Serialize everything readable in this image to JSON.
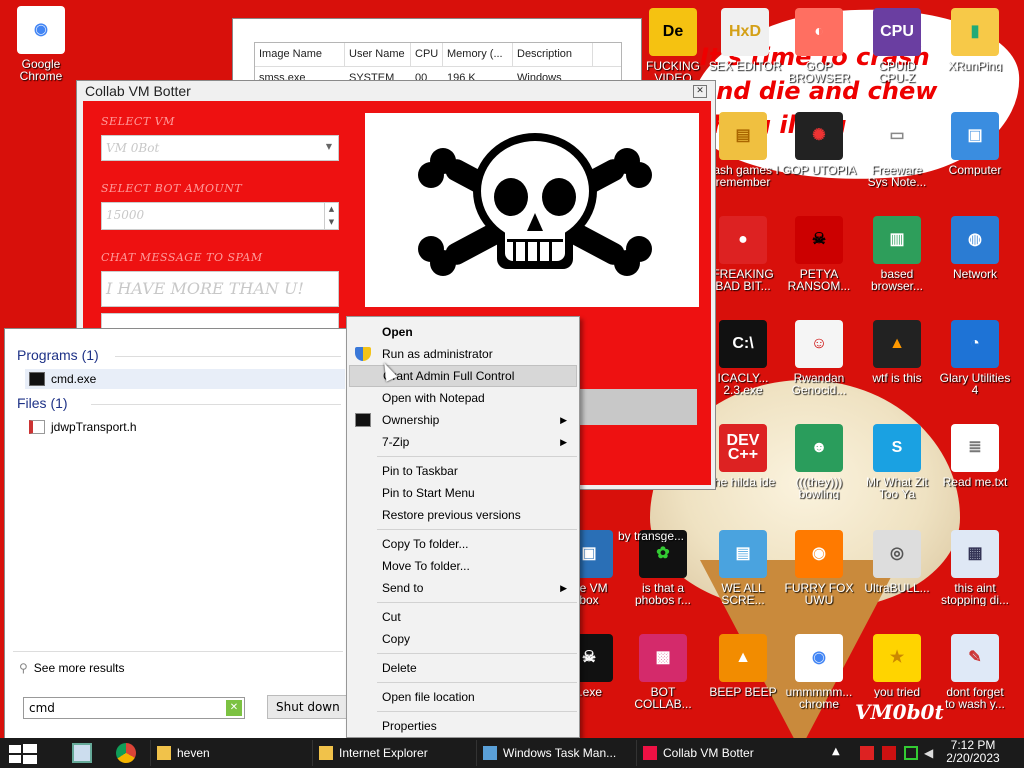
{
  "wallpaper": {
    "headline": "It's time to crash\nand die and chew\nthing illing",
    "signature": "VM0b0t"
  },
  "task_manager": {
    "columns": [
      "Image Name",
      "User Name",
      "CPU",
      "Memory (...",
      "Description"
    ],
    "row": [
      "smss.exe",
      "SYSTEM",
      "00",
      "196 K",
      "Windows"
    ]
  },
  "desktop_icons": [
    {
      "label": "Google\nChrome",
      "glyph": "◉",
      "bg": "#ffffff",
      "fg": "#4285f4"
    },
    {
      "label": "FUCKING\nVIDEO",
      "glyph": "De",
      "bg": "#f5c211",
      "fg": "#000"
    },
    {
      "label": "SEX EDITOR",
      "glyph": "HxD",
      "bg": "#f0f0f0",
      "fg": "#d4a017"
    },
    {
      "label": "GOP\nBROWSER",
      "glyph": "◐",
      "bg": "#ff6f61",
      "fg": "#fff"
    },
    {
      "label": "CPUID\nCPU-Z",
      "glyph": "CPU",
      "bg": "#6a3ea1",
      "fg": "#fff"
    },
    {
      "label": "XRunPing",
      "glyph": "▮",
      "bg": "#f7c948",
      "fg": "#2a7"
    },
    {
      "label": "flash games I\nremember",
      "glyph": "▤",
      "bg": "#f0c040",
      "fg": "#a60"
    },
    {
      "label": "GOP UTOPIA",
      "glyph": "✺",
      "bg": "#222",
      "fg": "#e33"
    },
    {
      "label": "Freeware\nSys Note...",
      "glyph": "▭",
      "bg": "#ffffff",
      "fg": "#888"
    },
    {
      "label": "Computer",
      "glyph": "▣",
      "bg": "#3a8de0",
      "fg": "#fff"
    },
    {
      "label": "FREAKING\nBAD BIT...",
      "glyph": "●",
      "bg": "#d22",
      "fg": "#fff"
    },
    {
      "label": "PETYA\nRANSOM...",
      "glyph": "☠",
      "bg": "#c00",
      "fg": "#000"
    },
    {
      "label": "based\nbrowser...",
      "glyph": "▥",
      "bg": "#2e9e5b",
      "fg": "#fff"
    },
    {
      "label": "Network",
      "glyph": "◍",
      "bg": "#2b7cd3",
      "fg": "#fff"
    },
    {
      "label": "ICACLY...\n2.3.exe",
      "glyph": "C:\\",
      "bg": "#111",
      "fg": "#fff"
    },
    {
      "label": "Rwandan\nGenocid...",
      "glyph": "☺",
      "bg": "#f5f5f5",
      "fg": "#c00"
    },
    {
      "label": "wtf is this",
      "glyph": "▲",
      "bg": "#222",
      "fg": "#f90"
    },
    {
      "label": "Glary Utilities\n4",
      "glyph": "◔",
      "bg": "#1e73d6",
      "fg": "#fff"
    },
    {
      "label": "the hilda ide",
      "glyph": "DEV\nC++",
      "bg": "#d22",
      "fg": "#fff"
    },
    {
      "label": "(((they)))\nbowling",
      "glyph": "☻",
      "bg": "#2a9d5c",
      "fg": "#fff"
    },
    {
      "label": "Mr What Zit\nToo Ya",
      "glyph": "S",
      "bg": "#1aa1e2",
      "fg": "#fff"
    },
    {
      "label": "Read me.txt",
      "glyph": "≣",
      "bg": "#ffffff",
      "fg": "#777"
    },
    {
      "label": "is that a\nphobos r...",
      "glyph": "✿",
      "bg": "#111",
      "fg": "#3c3"
    },
    {
      "label": "WE ALL\nSCRE...",
      "glyph": "▤",
      "bg": "#4aa3df",
      "fg": "#fff"
    },
    {
      "label": "FURRY FOX\nUWU",
      "glyph": "◉",
      "bg": "#ff7a00",
      "fg": "#fff"
    },
    {
      "label": "UltraBULL...",
      "glyph": "◎",
      "bg": "#ddd",
      "fg": "#555"
    },
    {
      "label": "this aint\nstopping di...",
      "glyph": "▦",
      "bg": "#dfe8f5",
      "fg": "#335"
    },
    {
      "label": "BOT\nCOLLAB...",
      "glyph": "▩",
      "bg": "#d42a6b",
      "fg": "#fff"
    },
    {
      "label": "BEEP BEEP",
      "glyph": "▲",
      "bg": "#f28c00",
      "fg": "#fff"
    },
    {
      "label": "ummmmm...\nchrome",
      "glyph": "◉",
      "bg": "#ffffff",
      "fg": "#4285f4"
    },
    {
      "label": "you tried",
      "glyph": "★",
      "bg": "#ffd400",
      "fg": "#c80"
    },
    {
      "label": "dont forget\nto wash y...",
      "glyph": "✎",
      "bg": "#dfe9f7",
      "fg": "#c33"
    },
    {
      "label": "dle VM\nbox",
      "glyph": "▣",
      "bg": "#2a6fb6",
      "fg": "#fff"
    },
    {
      "label": "t.exe",
      "glyph": "☠",
      "bg": "#111",
      "fg": "#fff"
    },
    {
      "label": "by transge...",
      "glyph": "",
      "bg": "transparent",
      "fg": "#fff"
    }
  ],
  "bot_window": {
    "title": "Collab VM Botter",
    "close": "✕",
    "select_vm_label": "SELECT VM",
    "select_vm_value": "VM 0Bot",
    "bot_amount_label": "SELECT BOT AMOUNT",
    "bot_amount_value": "15000",
    "chat_label": "CHAT MESSAGE TO SPAM",
    "chat_value": "I HAVE MORE THAN U!"
  },
  "start_menu": {
    "programs_header": "Programs (1)",
    "program_item": "cmd.exe",
    "files_header": "Files (1)",
    "file_item": "jdwpTransport.h",
    "see_more": "See more results",
    "search_value": "cmd",
    "shutdown_label": "Shut down"
  },
  "context_menu": {
    "items": [
      {
        "label": "Open",
        "bold": true
      },
      {
        "label": "Run as administrator",
        "icon": "shield"
      },
      {
        "label": "Grant Admin Full Control",
        "hover": true
      },
      {
        "label": "Open with Notepad"
      },
      {
        "label": "Ownership",
        "icon": "cmd",
        "submenu": true
      },
      {
        "label": "7-Zip",
        "submenu": true
      },
      {
        "label": "Pin to Taskbar",
        "sep_before": true
      },
      {
        "label": "Pin to Start Menu"
      },
      {
        "label": "Restore previous versions"
      },
      {
        "label": "Copy To folder...",
        "sep_before": true
      },
      {
        "label": "Move To folder..."
      },
      {
        "label": "Send to",
        "submenu": true
      },
      {
        "label": "Cut",
        "sep_before": true
      },
      {
        "label": "Copy"
      },
      {
        "label": "Delete",
        "sep_before": true
      },
      {
        "label": "Open file location",
        "sep_before": true
      },
      {
        "label": "Properties",
        "sep_before": true
      }
    ]
  },
  "taskbar": {
    "apps": [
      {
        "label": "heven",
        "icon": "folder"
      },
      {
        "label": "Internet Explorer",
        "icon": "folder"
      },
      {
        "label": "Windows Task Man...",
        "icon": "taskmgr"
      },
      {
        "label": "Collab VM Botter",
        "icon": "botter"
      }
    ],
    "clock_time": "7:12 PM",
    "clock_date": "2/20/2023"
  },
  "colors": {
    "wallpaper_red": "#d8100b",
    "bot_red": "#ee1111",
    "taskbar": "#1b1b1b"
  }
}
